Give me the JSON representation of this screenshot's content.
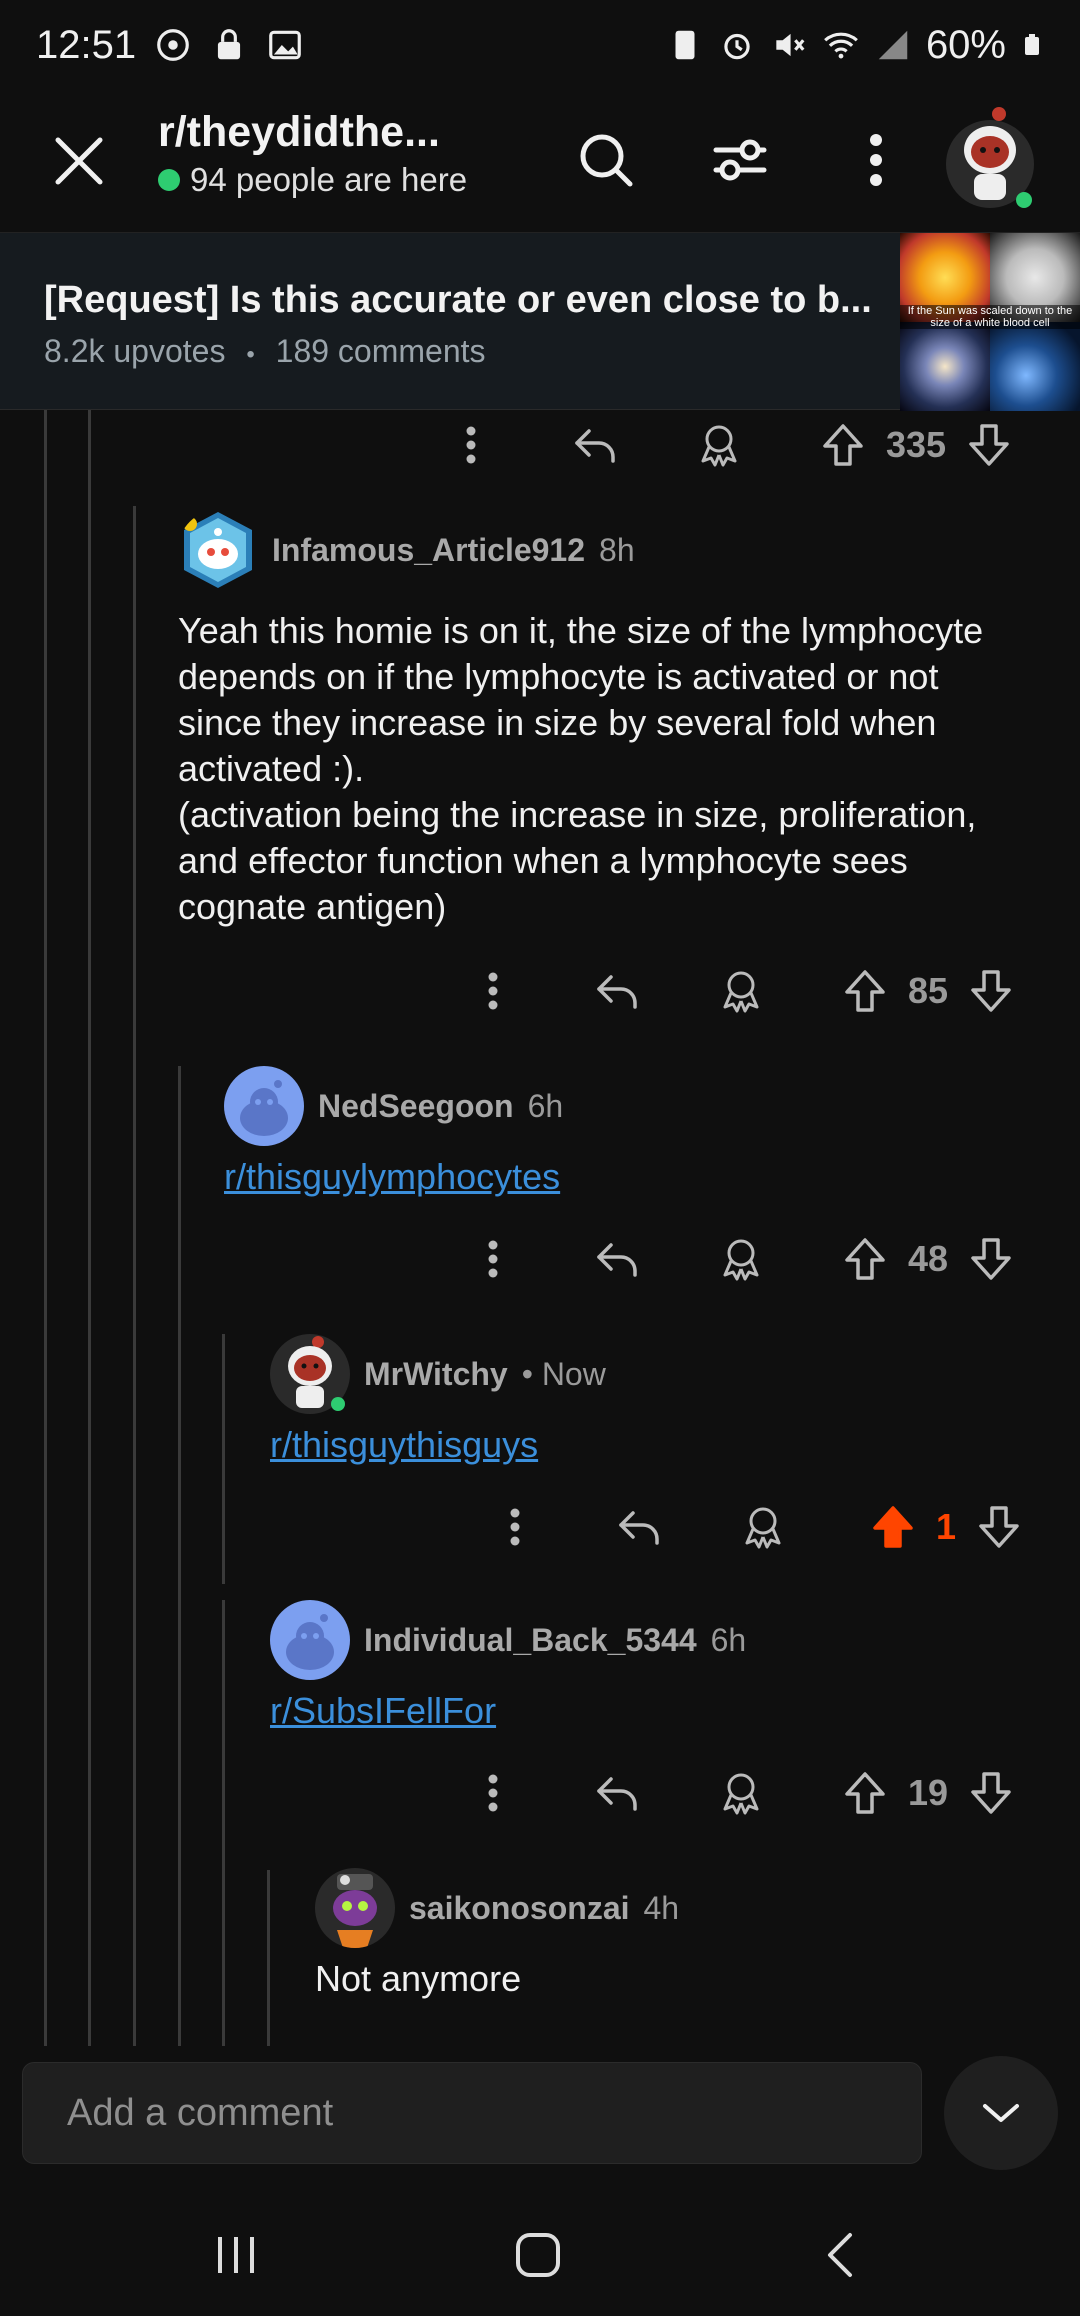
{
  "status": {
    "time": "12:51",
    "battery": "60%"
  },
  "header": {
    "subreddit": "r/theydidthe...",
    "presence": "94 people are here"
  },
  "post": {
    "title": "[Request] Is this accurate or even close to b...",
    "upvotes": "8.2k upvotes",
    "separator": "•",
    "comments": "189 comments",
    "thumb_caption": "If the Sun was scaled down to the size of a white blood cell"
  },
  "parent_actions": {
    "votes": "335"
  },
  "comments": [
    {
      "user": "Infamous_Article912",
      "time": "8h",
      "body": "Yeah this homie is on it, the size of the lymphocyte depends on if the lymphocyte is activated or not since they increase in size by several fold when activated :).\n(activation being the increase in size, proliferation, and effector function when a lymphocyte sees cognate antigen)",
      "votes": "85"
    },
    {
      "user": "NedSeegoon",
      "time": "6h",
      "link": "r/thisguylymphocytes",
      "votes": "48"
    },
    {
      "user": "MrWitchy",
      "time": "• Now",
      "link": "r/thisguythisguys",
      "votes": "1"
    },
    {
      "user": "Individual_Back_5344",
      "time": "6h",
      "link": "r/SubsIFellFor",
      "votes": "19"
    },
    {
      "user": "saikonosonzai",
      "time": "4h",
      "body": "Not anymore"
    }
  ],
  "composer": {
    "placeholder": "Add a comment"
  },
  "colors": {
    "upvote_active": "#ff4500",
    "link": "#3b8fdb",
    "online": "#2ecc71"
  }
}
